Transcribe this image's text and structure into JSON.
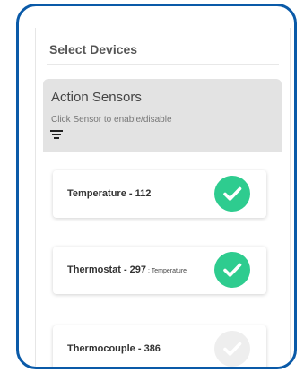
{
  "colors": {
    "frame_border": "#0a5aa8",
    "header_bg": "#e3e3e3",
    "check_enabled": "#2ecc8f",
    "check_disabled": "#eeeeee"
  },
  "panel": {
    "title": "Select Devices"
  },
  "sensors": {
    "title": "Action Sensors",
    "hint": "Click Sensor to enable/disable",
    "filter_icon": "filter-icon",
    "items": [
      {
        "name": "Temperature",
        "id_text": " - 112",
        "sub": "",
        "enabled": true,
        "icon": "check-circle-icon"
      },
      {
        "name": "Thermostat",
        "id_text": " - 297",
        "sub": " : Temperature",
        "enabled": true,
        "icon": "check-circle-icon"
      },
      {
        "name": "Thermocouple",
        "id_text": " - 386",
        "sub": "",
        "enabled": false,
        "icon": "check-circle-icon"
      }
    ]
  }
}
